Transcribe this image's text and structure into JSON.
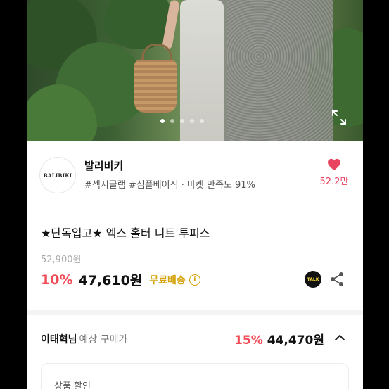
{
  "hero": {
    "slide_count": 5,
    "active_slide": 1
  },
  "seller": {
    "logo_text": "BALIBIKI",
    "name": "발리비키",
    "tags": "#섹시글램 #심플베이직 · 마켓 만족도 91%",
    "like_count": "52.2만"
  },
  "product": {
    "title": "★단독입고★ 엑스 홀터 니트 투피스",
    "original_price": "52,900원",
    "discount": "10%",
    "price": "47,610원",
    "shipping": "무료배송",
    "info_icon": "i",
    "talk_label": "TALK"
  },
  "buyer": {
    "name": "이태혁님",
    "label": "예상 구매가",
    "discount": "15%",
    "price": "44,470원"
  },
  "coupon": {
    "label": "상품 할인"
  },
  "colors": {
    "accent_red": "#ef4a55",
    "shipping_yellow": "#d4a20a",
    "heart": "#e94560"
  }
}
